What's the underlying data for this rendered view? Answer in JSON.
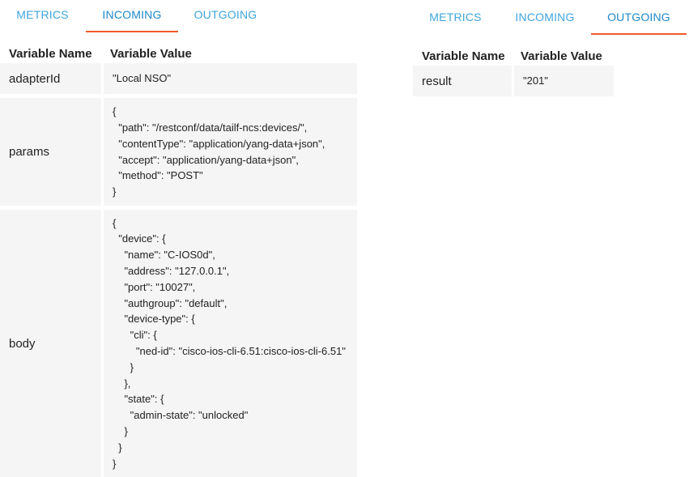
{
  "tabs": {
    "metrics": "METRICS",
    "incoming": "INCOMING",
    "outgoing": "OUTGOING"
  },
  "incoming_table": {
    "headers": {
      "name": "Variable Name",
      "value": "Variable Value"
    },
    "rows": [
      {
        "name": "adapterId",
        "value": "\"Local NSO\""
      },
      {
        "name": "params",
        "value": "{\n  \"path\": \"/restconf/data/tailf-ncs:devices/\",\n  \"contentType\": \"application/yang-data+json\",\n  \"accept\": \"application/yang-data+json\",\n  \"method\": \"POST\"\n}"
      },
      {
        "name": "body",
        "value": "{\n  \"device\": {\n    \"name\": \"C-IOS0d\",\n    \"address\": \"127.0.0.1\",\n    \"port\": \"10027\",\n    \"authgroup\": \"default\",\n    \"device-type\": {\n      \"cli\": {\n        \"ned-id\": \"cisco-ios-cli-6.51:cisco-ios-cli-6.51\"\n      }\n    },\n    \"state\": {\n      \"admin-state\": \"unlocked\"\n    }\n  }\n}"
      }
    ]
  },
  "outgoing_table": {
    "headers": {
      "name": "Variable Name",
      "value": "Variable Value"
    },
    "rows": [
      {
        "name": "result",
        "value": "\"201\""
      }
    ]
  },
  "colors": {
    "tab_text": "#3fa4dc",
    "tab_active_text": "#1e88c8",
    "tab_underline": "#f05a28",
    "cell_background": "#f5f5f5"
  }
}
